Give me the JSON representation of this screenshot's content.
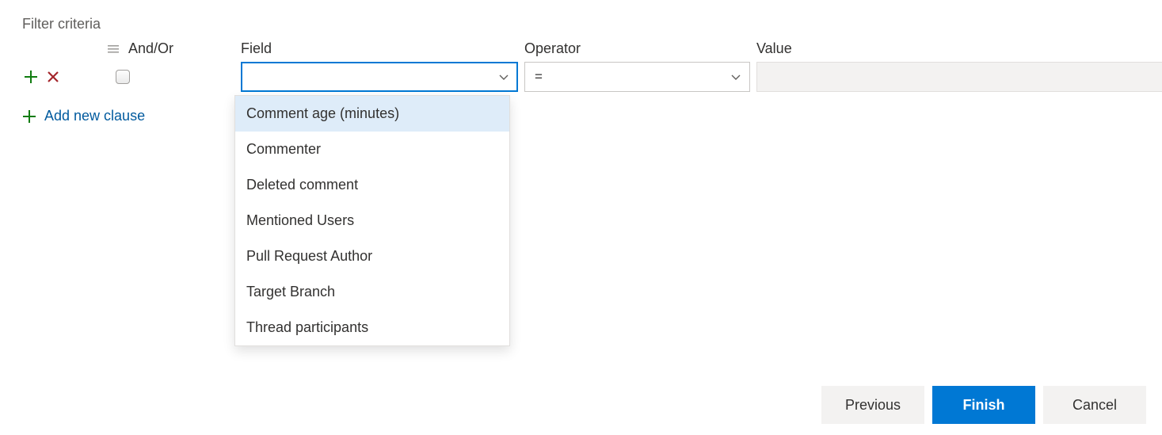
{
  "title": "Filter criteria",
  "headers": {
    "andor": "And/Or",
    "field": "Field",
    "operator": "Operator",
    "value": "Value"
  },
  "row": {
    "field_value": "",
    "operator_value": "="
  },
  "field_options": [
    "Comment age (minutes)",
    "Commenter",
    "Deleted comment",
    "Mentioned Users",
    "Pull Request Author",
    "Target Branch",
    "Thread participants"
  ],
  "links": {
    "add_clause": "Add new clause"
  },
  "buttons": {
    "previous": "Previous",
    "finish": "Finish",
    "cancel": "Cancel"
  }
}
